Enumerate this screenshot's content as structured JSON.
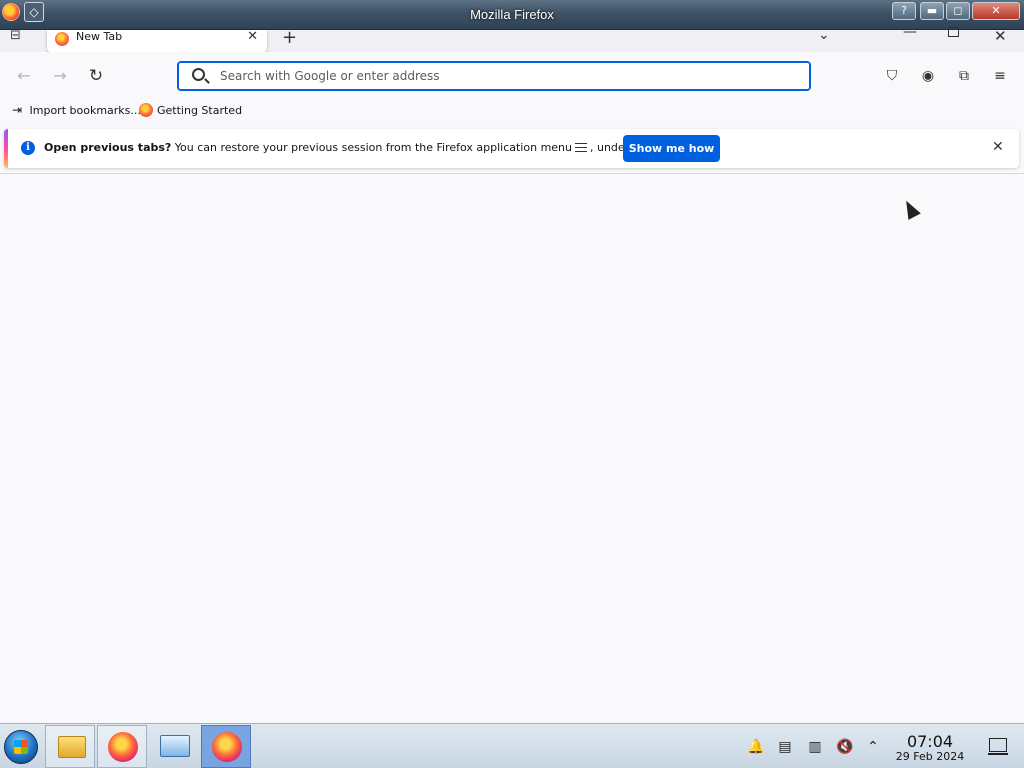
{
  "window": {
    "title": "Mozilla Firefox",
    "menu_glyph": "◇",
    "help_glyph": "?",
    "min_glyph": "▬",
    "max_glyph": "◻",
    "close_glyph": "✕"
  },
  "tabs": {
    "active_tab_label": "New Tab",
    "close_glyph": "✕",
    "new_tab_glyph": "+",
    "list_glyph": "⊟",
    "dropdown_glyph": "⌄",
    "min_glyph": "—",
    "close_window_glyph": "✕"
  },
  "navbar": {
    "back_glyph": "←",
    "forward_glyph": "→",
    "reload_glyph": "↻",
    "url_placeholder": "Search with Google or enter address",
    "pocket_glyph": "⛉",
    "account_glyph": "◉",
    "extensions_glyph": "⧉",
    "menu_glyph": "≡"
  },
  "bookmarks": {
    "import_icon": "⇥",
    "import_label": "Import bookmarks...",
    "getting_started_label": "Getting Started"
  },
  "notification": {
    "info_glyph": "i",
    "bold_text": "Open previous tabs?",
    "text_before_icon": " You can restore your previous session from the Firefox application menu",
    "text_after_icon": ", under History.",
    "button_label": "Show me how",
    "close_glyph": "✕"
  },
  "taskbar": {
    "tray_notif_glyph": "🔔",
    "tray_clip_glyph": "▤",
    "tray_batt_glyph": "▥",
    "tray_vol_glyph": "🔇",
    "tray_up_glyph": "⌃",
    "time": "07:04",
    "date": "29 Feb 2024"
  },
  "colors": {
    "accent": "#0061e0",
    "taskbar_selected": "#79a4e0"
  }
}
